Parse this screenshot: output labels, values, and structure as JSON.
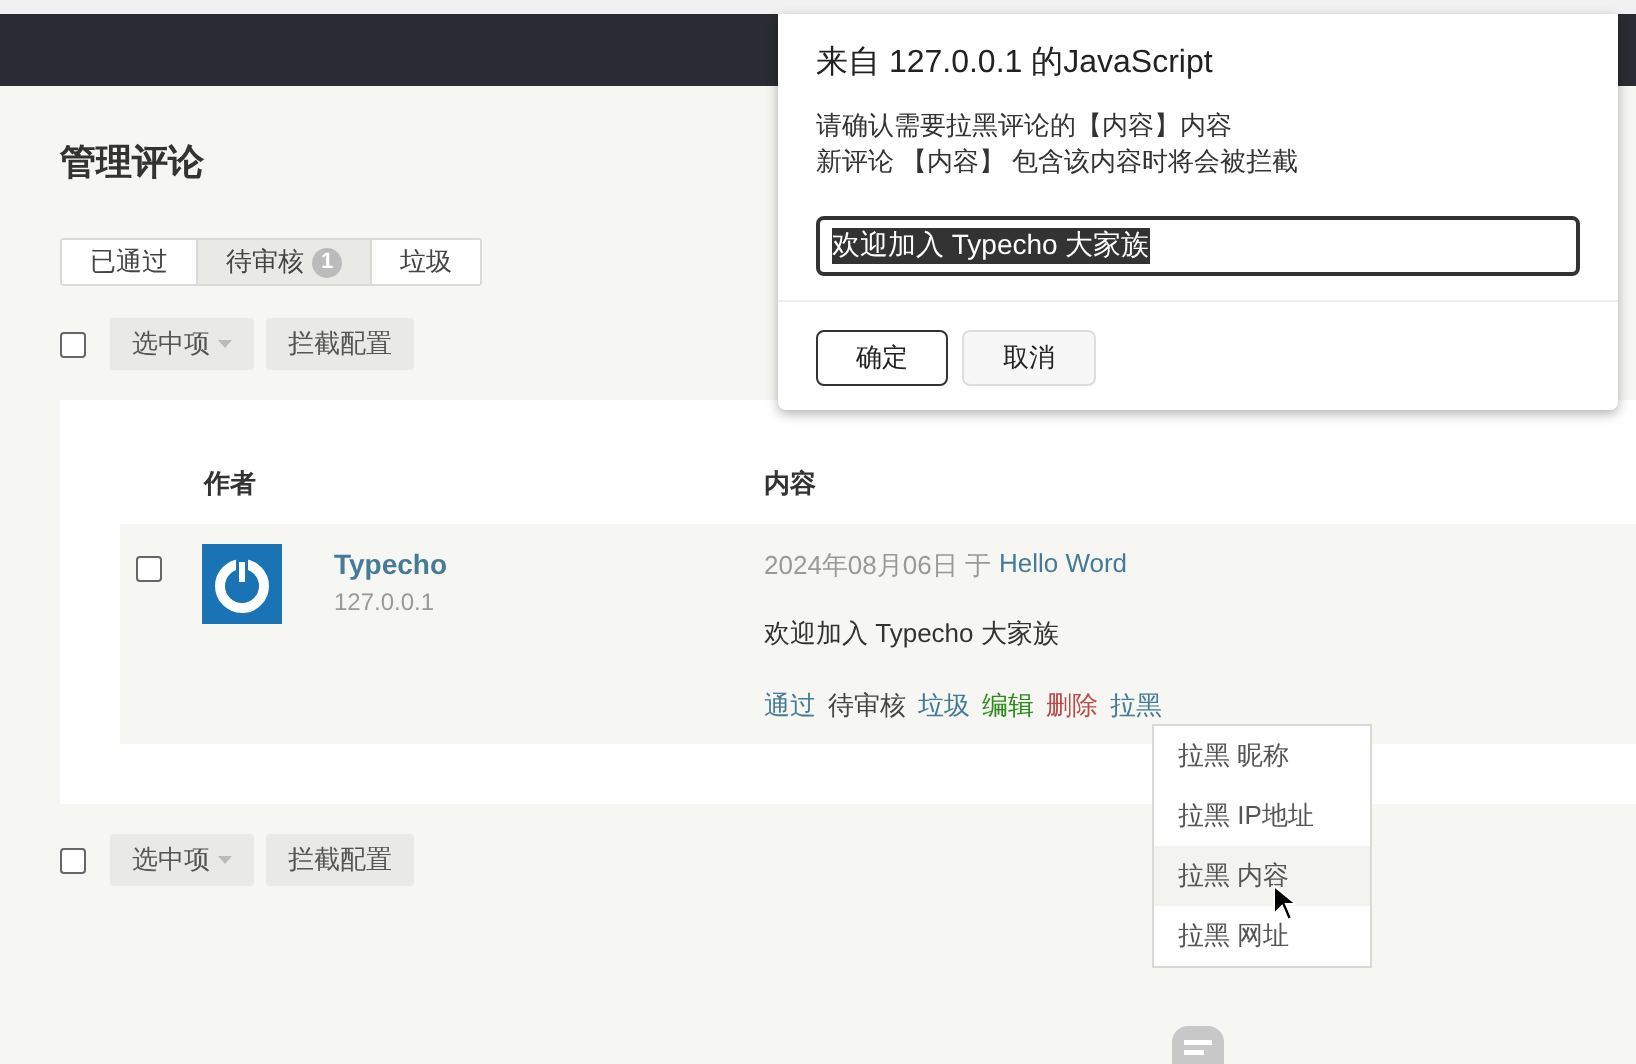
{
  "page": {
    "title": "管理评论"
  },
  "tabs": [
    {
      "label": "已通过",
      "selected": false
    },
    {
      "label": "待审核",
      "badge": "1",
      "selected": true
    },
    {
      "label": "垃圾",
      "selected": false
    }
  ],
  "toolbar_top": {
    "checked": false,
    "select_label": "选中项",
    "config_label": "拦截配置"
  },
  "table": {
    "columns": [
      "作者",
      "内容"
    ],
    "rows": [
      {
        "checked": false,
        "author": "Typecho",
        "ip": "127.0.0.1",
        "date": "2024年08月06日 于",
        "post": "Hello Word",
        "text": "欢迎加入 Typecho 大家族",
        "actions": [
          {
            "label": "通过",
            "color": "#467b96"
          },
          {
            "label": "待审核",
            "color": "#444444"
          },
          {
            "label": "垃圾",
            "color": "#467b96"
          },
          {
            "label": "编辑",
            "color": "#2a8a1a"
          },
          {
            "label": "删除",
            "color": "#b94a48"
          },
          {
            "label": "拉黑",
            "color": "#467b96"
          }
        ]
      }
    ]
  },
  "toolbar_bottom": {
    "checked": false,
    "select_label": "选中项",
    "config_label": "拦截配置"
  },
  "dropdown": {
    "items": [
      {
        "label": "拉黑 昵称",
        "selected": false
      },
      {
        "label": "拉黑 IP地址",
        "selected": false
      },
      {
        "label": "拉黑 内容",
        "selected": true
      },
      {
        "label": "拉黑 网址",
        "selected": false
      }
    ]
  },
  "dialog": {
    "title": "来自 127.0.0.1 的JavaScript",
    "message": [
      "请确认需要拉黑评论的【内容】内容",
      "新评论 【内容】 包含该内容时将会被拦截"
    ],
    "value": "欢迎加入 Typecho 大家族",
    "value_selected": true,
    "buttons": [
      {
        "label": "确定",
        "selected": true
      },
      {
        "label": "取消",
        "selected": false
      }
    ]
  }
}
